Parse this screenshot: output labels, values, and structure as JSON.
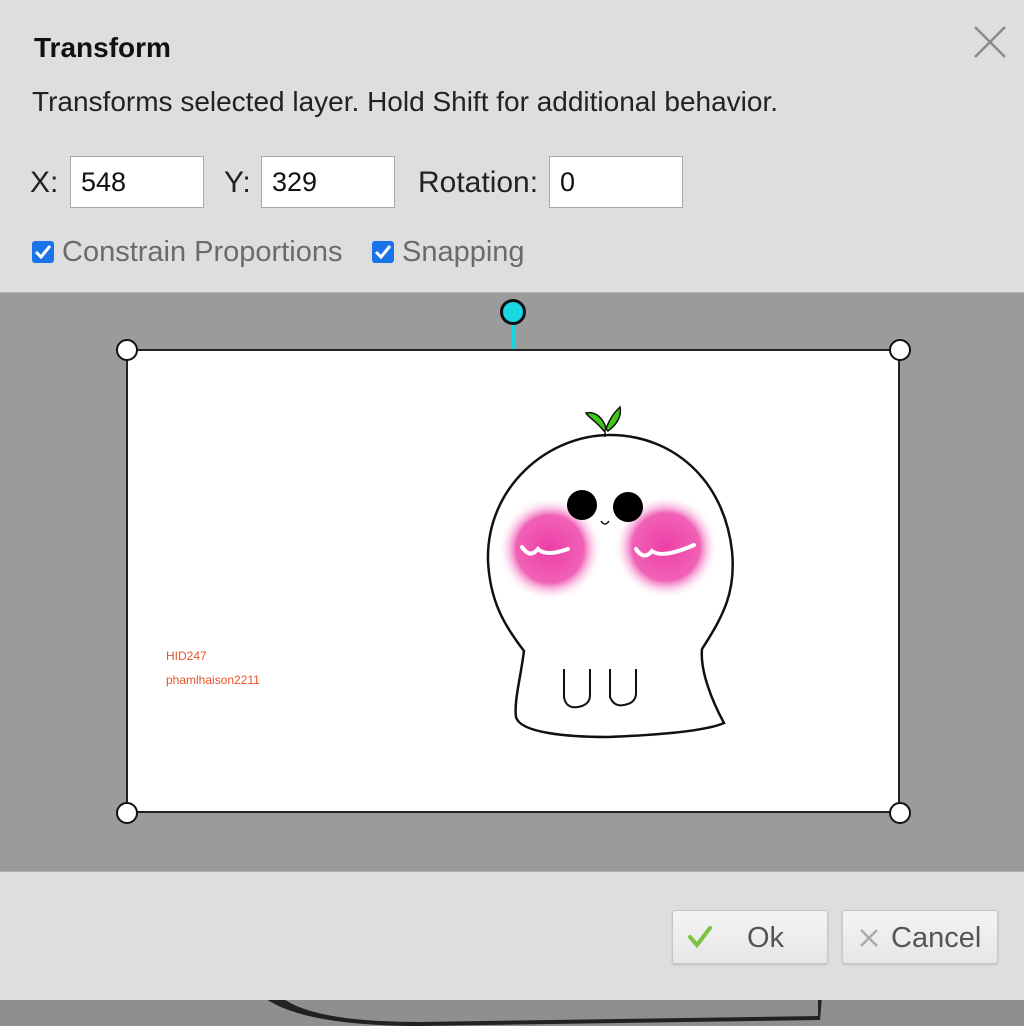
{
  "dialog": {
    "title": "Transform",
    "description": "Transforms selected layer. Hold Shift for additional behavior."
  },
  "fields": {
    "x": {
      "label": "X:",
      "value": "548"
    },
    "y": {
      "label": "Y:",
      "value": "329"
    },
    "rotation": {
      "label": "Rotation:",
      "value": "0"
    }
  },
  "options": {
    "constrain": {
      "label": "Constrain Proportions",
      "checked": true
    },
    "snapping": {
      "label": "Snapping",
      "checked": true
    }
  },
  "preview": {
    "watermark_line1": "HID247",
    "watermark_line2": "phamlhaison2211"
  },
  "buttons": {
    "ok_label": "Ok",
    "cancel_label": "Cancel"
  },
  "colors": {
    "rotate_handle": "#19d6e0",
    "checkbox": "#1a73e8",
    "ok_check": "#7cc242",
    "blush": "#ee3fa8",
    "sprout": "#3fc81c"
  }
}
